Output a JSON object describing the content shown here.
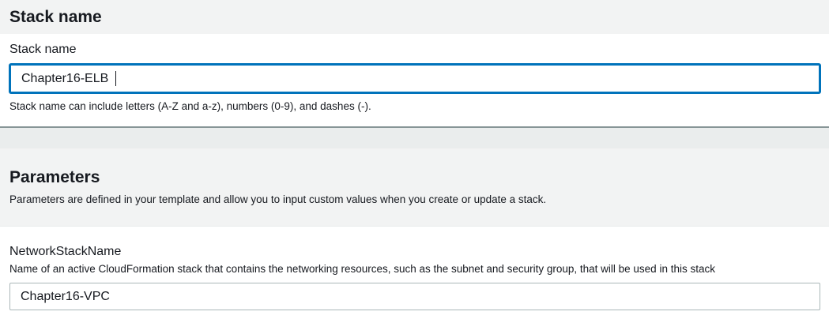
{
  "stack_name_section": {
    "title": "Stack name",
    "field_label": "Stack name",
    "value": "Chapter16-ELB",
    "hint": "Stack name can include letters (A-Z and a-z), numbers (0-9), and dashes (-)."
  },
  "parameters_section": {
    "title": "Parameters",
    "description": "Parameters are defined in your template and allow you to input custom values when you create or update a stack.",
    "params": [
      {
        "name": "NetworkStackName",
        "description": "Name of an active CloudFormation stack that contains the networking resources, such as the subnet and security group, that will be used in this stack",
        "value": "Chapter16-VPC"
      }
    ]
  },
  "colors": {
    "focus_border": "#0073bb",
    "header_bg": "#f2f3f3",
    "text": "#16191f"
  }
}
